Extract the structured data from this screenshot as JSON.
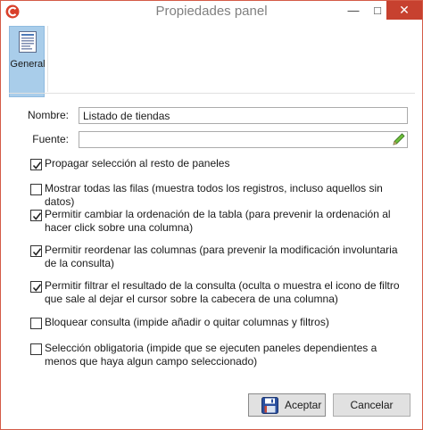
{
  "window": {
    "title": "Propiedades panel",
    "close_glyph": "✕",
    "minimize_glyph": "—",
    "maximize_glyph": "□"
  },
  "toolbar": {
    "general_label": "General"
  },
  "form": {
    "nombre_label": "Nombre:",
    "nombre_value": "Listado de tiendas",
    "fuente_label": "Fuente:",
    "fuente_value": ""
  },
  "options": [
    {
      "label": "Propagar selección al resto de paneles",
      "checked": true
    },
    {
      "label": "Mostrar todas las filas (muestra todos los registros, incluso aquellos sin datos)",
      "checked": false
    },
    {
      "label": "Permitir cambiar la ordenación de la tabla (para prevenir la ordenación al hacer click sobre una columna)",
      "checked": true
    },
    {
      "label": "Permitir reordenar las columnas (para prevenir la modificación involuntaria de la consulta)",
      "checked": true
    },
    {
      "label": "Permitir filtrar el resultado de la consulta (oculta o muestra el icono de filtro que sale al dejar el cursor sobre la cabecera de una columna)",
      "checked": true
    },
    {
      "label": "Bloquear consulta (impide añadir o quitar columnas y filtros)",
      "checked": false
    },
    {
      "label": "Selección obligatoria (impide que se ejecuten paneles dependientes a menos que haya algun campo seleccionado)",
      "checked": false
    }
  ],
  "buttons": {
    "accept_label": "Aceptar",
    "cancel_label": "Cancelar"
  },
  "icons": {
    "app": "app-logo-icon",
    "general": "document-list-icon",
    "fuente_picker": "pencil-icon",
    "accept": "save-icon"
  },
  "colors": {
    "accent": "#c7412f",
    "selected_tool": "#a9cdea"
  }
}
